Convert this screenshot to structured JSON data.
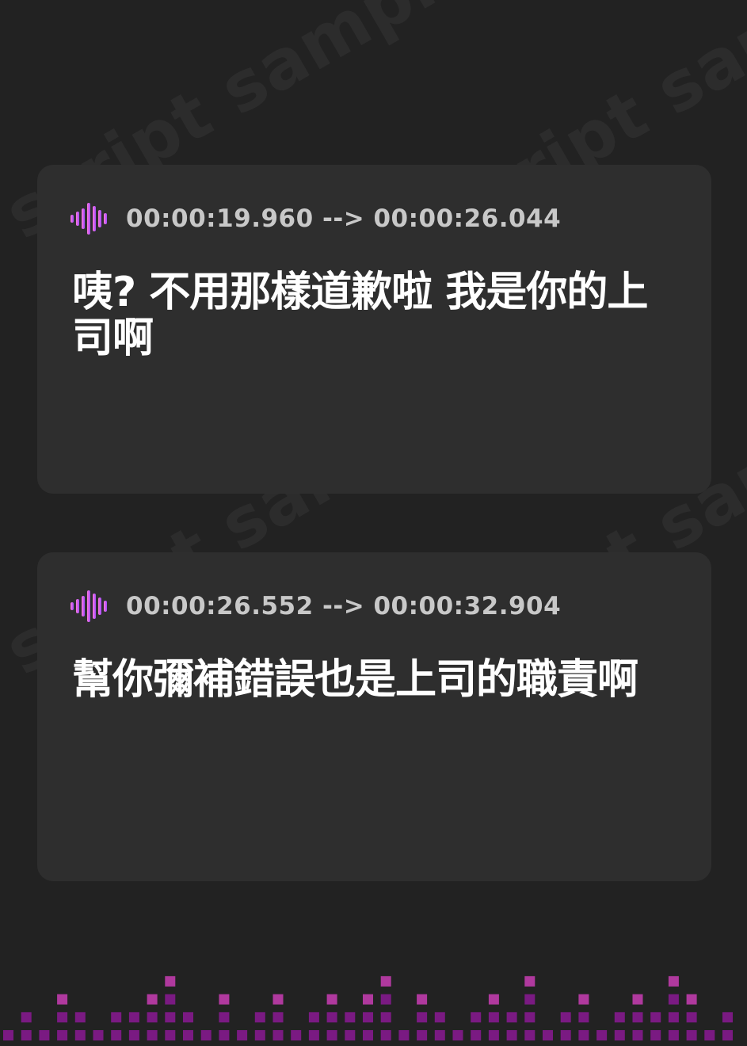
{
  "watermark": {
    "text": "script sample"
  },
  "cards": [
    {
      "timestamp": "00:00:19.960 --> 00:00:26.044",
      "text": "咦? 不用那樣道歉啦 我是你的上司啊"
    },
    {
      "timestamp": "00:00:26.552 --> 00:00:32.904",
      "text": "幫你彌補錯誤也是上司的職責啊"
    }
  ],
  "colors": {
    "background": "#222222",
    "card": "#2e2e2e",
    "icon_gradient_start": "#ff7ad9",
    "icon_gradient_end": "#a14bff",
    "equalizer_dim": "#7a1a82",
    "equalizer_bright": "#b0399e"
  },
  "icons": {
    "waveform": "audio-waveform-icon"
  }
}
